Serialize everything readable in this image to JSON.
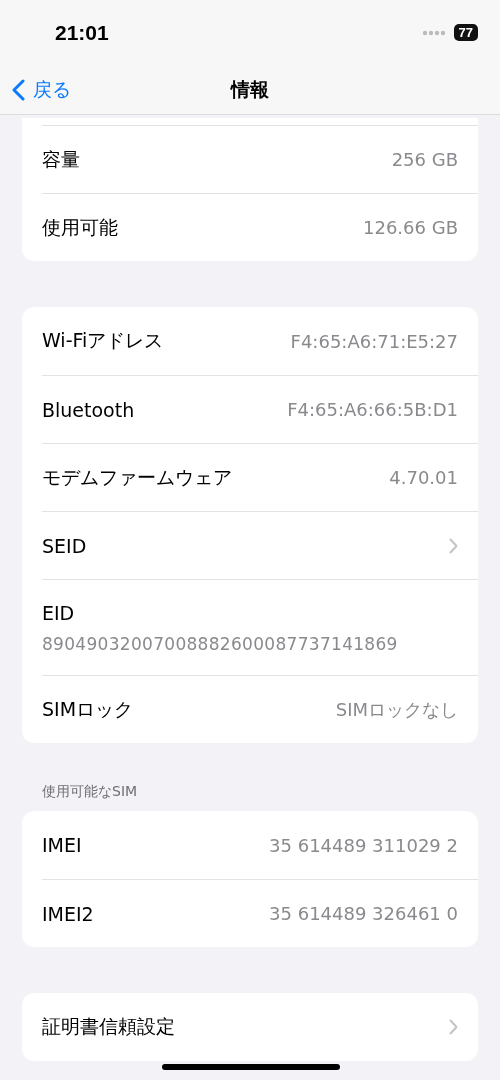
{
  "status_bar": {
    "time": "21:01",
    "battery": "77"
  },
  "nav": {
    "back": "戻る",
    "title": "情報"
  },
  "groups": [
    {
      "rows": [
        {
          "kind": "value",
          "label": "容量",
          "value": "256 GB"
        },
        {
          "kind": "value",
          "label": "使用可能",
          "value": "126.66 GB"
        }
      ]
    },
    {
      "rows": [
        {
          "kind": "value",
          "label": "Wi-Fiアドレス",
          "value": "F4:65:A6:71:E5:27"
        },
        {
          "kind": "value",
          "label": "Bluetooth",
          "value": "F4:65:A6:66:5B:D1"
        },
        {
          "kind": "value",
          "label": "モデムファームウェア",
          "value": "4.70.01"
        },
        {
          "kind": "chevron",
          "label": "SEID"
        },
        {
          "kind": "stacked",
          "label": "EID",
          "value": "89049032007008882600087737141869"
        },
        {
          "kind": "value",
          "label": "SIMロック",
          "value": "SIMロックなし"
        }
      ]
    },
    {
      "header": "使用可能なSIM",
      "rows": [
        {
          "kind": "value",
          "label": "IMEI",
          "value": "35 614489 311029 2"
        },
        {
          "kind": "value",
          "label": "IMEI2",
          "value": "35 614489 326461 0"
        }
      ]
    },
    {
      "rows": [
        {
          "kind": "chevron",
          "label": "証明書信頼設定"
        }
      ]
    }
  ]
}
